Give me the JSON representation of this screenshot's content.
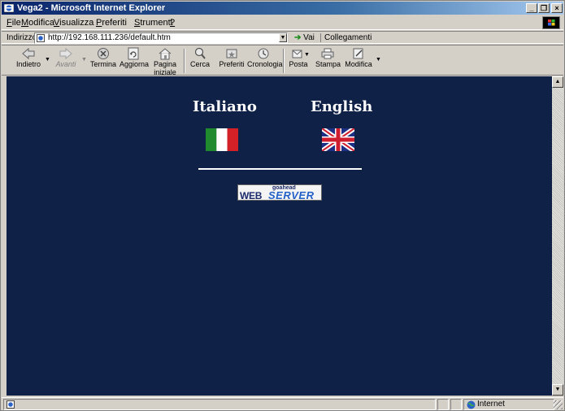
{
  "window": {
    "title": "Vega2 - Microsoft Internet Explorer",
    "minimize": "_",
    "maximize": "❐",
    "close": "×"
  },
  "menu": [
    {
      "key": "F",
      "rest": "ile"
    },
    {
      "key": "M",
      "rest": "odifica"
    },
    {
      "key": "V",
      "rest": "isualizza"
    },
    {
      "key": "P",
      "rest": "referiti"
    },
    {
      "key": "S",
      "rest": "trumenti"
    },
    {
      "key": "?",
      "rest": ""
    }
  ],
  "address": {
    "label": "Indirizzo",
    "url": "http://192.168.111.236/default.htm",
    "go_label": "Vai",
    "links_label": "Collegamenti"
  },
  "toolbar": {
    "back": "Indietro",
    "forward": "Avanti",
    "stop": "Termina",
    "refresh": "Aggiorna",
    "home_line1": "Pagina",
    "home_line2": "iniziale",
    "search": "Cerca",
    "favorites": "Preferiti",
    "history": "Cronologia",
    "mail": "Posta",
    "print": "Stampa",
    "edit": "Modifica"
  },
  "page": {
    "italian_label": "Italiano",
    "english_label": "English",
    "logo_small": "goahead",
    "logo_web": "WEB",
    "logo_server": "SERVER"
  },
  "status": {
    "zone": "Internet"
  },
  "colors": {
    "page_background": "#0f2147",
    "title_bar": "#0a246a"
  }
}
